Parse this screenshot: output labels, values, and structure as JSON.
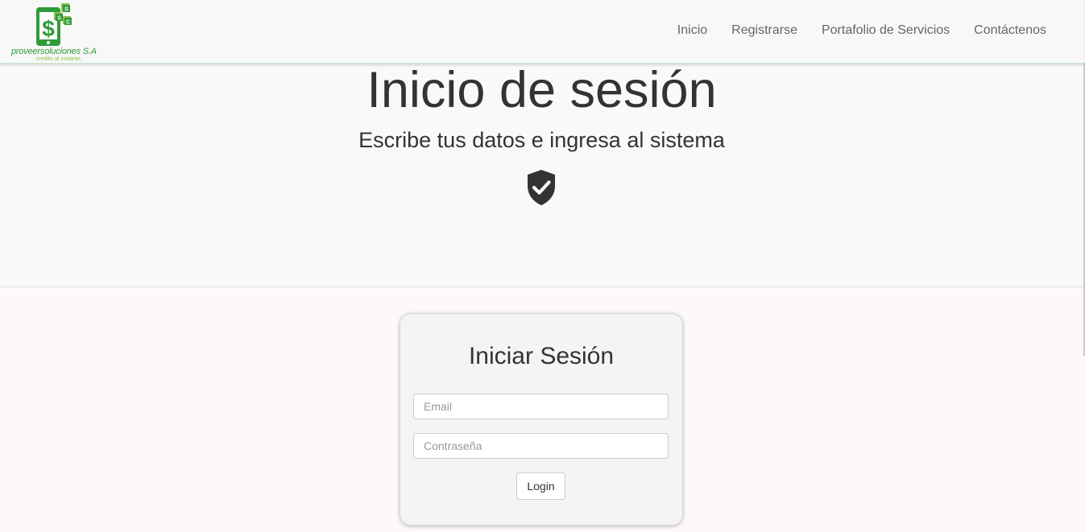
{
  "navbar": {
    "logo": {
      "name": "proveersoluciones S.A",
      "tagline": "credito al instante.",
      "letters": [
        "S",
        "S",
        "C"
      ],
      "brand_color": "#2e9b3a"
    },
    "links": [
      {
        "label": "Inicio"
      },
      {
        "label": "Registrarse"
      },
      {
        "label": "Portafolio de Servicios"
      },
      {
        "label": "Contáctenos"
      }
    ]
  },
  "hero": {
    "title": "Inicio de sesión",
    "subtitle": "Escribe tus datos e ingresa al sistema",
    "icon": "shield-check-icon"
  },
  "login_card": {
    "title": "Iniciar Sesión",
    "email": {
      "placeholder": "Email",
      "value": ""
    },
    "password": {
      "placeholder": "Contraseña",
      "value": ""
    },
    "submit_label": "Login"
  },
  "colors": {
    "hero_bg": "#f9f9f9",
    "page_bg": "#fdf9f8",
    "card_bg": "#f4f4f4",
    "text": "#333333",
    "nav_text": "#666666"
  }
}
